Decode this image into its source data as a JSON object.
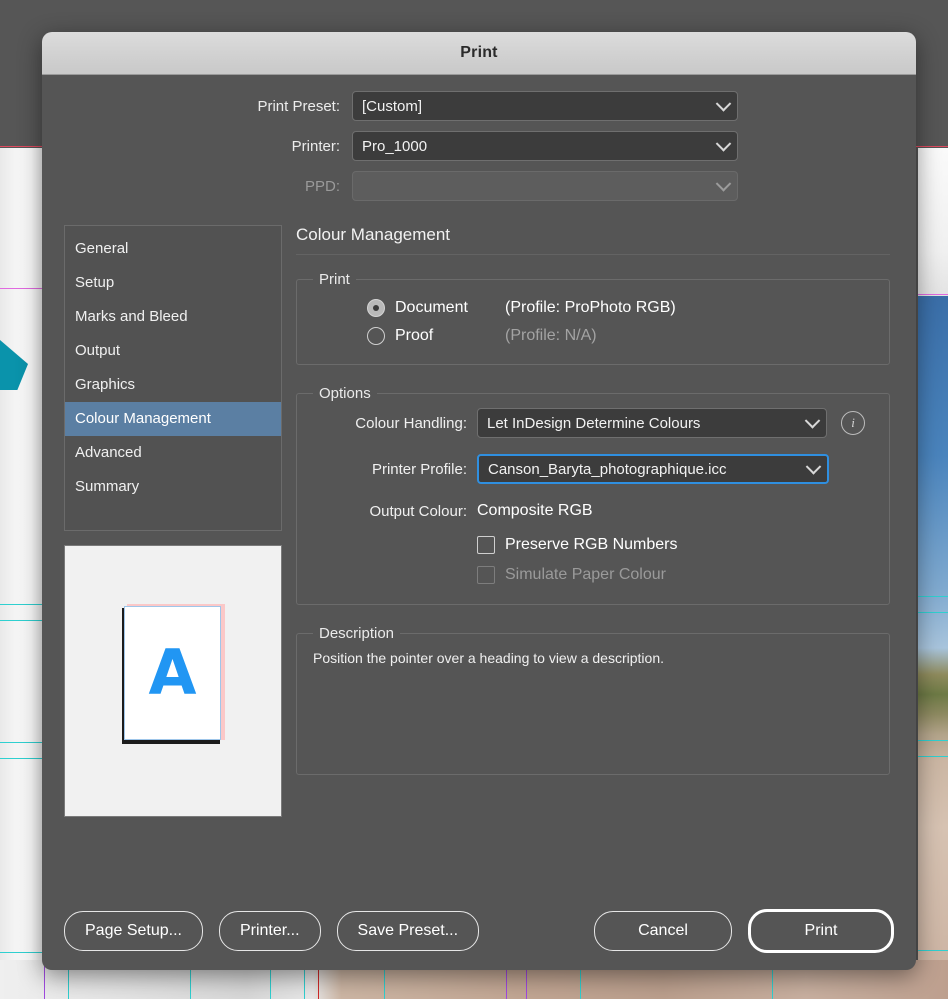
{
  "window": {
    "title": "Print"
  },
  "top_fields": [
    {
      "label": "Print Preset:",
      "value": "[Custom]",
      "disabled": false,
      "name": "print-preset"
    },
    {
      "label": "Printer:",
      "value": "Pro_1000",
      "disabled": false,
      "name": "printer"
    },
    {
      "label": "PPD:",
      "value": "",
      "disabled": true,
      "name": "ppd"
    }
  ],
  "sidebar": {
    "items": [
      {
        "label": "General",
        "selected": false
      },
      {
        "label": "Setup",
        "selected": false
      },
      {
        "label": "Marks and Bleed",
        "selected": false
      },
      {
        "label": "Output",
        "selected": false
      },
      {
        "label": "Graphics",
        "selected": false
      },
      {
        "label": "Colour Management",
        "selected": true
      },
      {
        "label": "Advanced",
        "selected": false
      },
      {
        "label": "Summary",
        "selected": false
      }
    ]
  },
  "preview": {
    "glyph": "A"
  },
  "panel": {
    "title": "Colour Management",
    "print_group": {
      "legend": "Print",
      "options": [
        {
          "label": "Document",
          "profile": "(Profile: ProPhoto RGB)",
          "selected": true,
          "dim": false
        },
        {
          "label": "Proof",
          "profile": "(Profile: N/A)",
          "selected": false,
          "dim": true
        }
      ]
    },
    "options_group": {
      "legend": "Options",
      "colour_handling_label": "Colour Handling:",
      "colour_handling_value": "Let InDesign Determine Colours",
      "info_icon_glyph": "i",
      "printer_profile_label": "Printer Profile:",
      "printer_profile_value": "Canson_Baryta_photographique.icc",
      "output_colour_label": "Output Colour:",
      "output_colour_value": "Composite RGB",
      "checkboxes": [
        {
          "label": "Preserve RGB Numbers",
          "checked": false,
          "disabled": false
        },
        {
          "label": "Simulate Paper Colour",
          "checked": false,
          "disabled": true
        }
      ]
    },
    "description_group": {
      "legend": "Description",
      "text": "Position the pointer over a heading to view a description."
    }
  },
  "footer": {
    "buttons": [
      {
        "label": "Page Setup...",
        "default": false,
        "name": "page-setup-button"
      },
      {
        "label": "Printer...",
        "default": false,
        "name": "printer-button"
      },
      {
        "label": "Save Preset...",
        "default": false,
        "name": "save-preset-button"
      },
      {
        "label": "Cancel",
        "default": false,
        "name": "cancel-button"
      },
      {
        "label": "Print",
        "default": true,
        "name": "print-button"
      }
    ]
  },
  "colors": {
    "dialog_bg": "#555555",
    "titlebar_bg": "#d0d0d0",
    "selection_blue": "#5b7fa3",
    "focus_blue": "#2f8fe0",
    "field_bg": "#3c3c3c",
    "preview_glyph": "#2196f3"
  }
}
